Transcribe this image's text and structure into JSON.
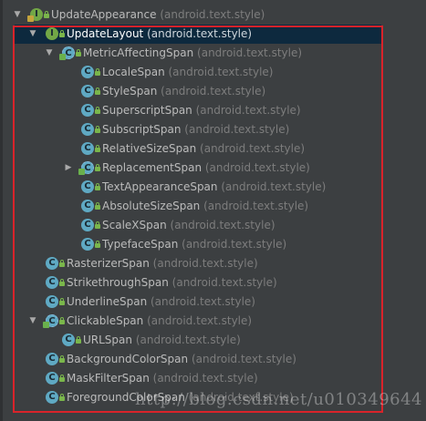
{
  "tree": {
    "rows": [
      {
        "label": "UpdateAppearance",
        "pkg": "(android.text.style)",
        "kind": "interface-ext",
        "arrow": "down",
        "selected": false
      },
      {
        "label": "UpdateLayout",
        "pkg": "(android.text.style)",
        "kind": "interface",
        "arrow": "down",
        "selected": true
      },
      {
        "label": "MetricAffectingSpan",
        "pkg": "(android.text.style)",
        "kind": "abstract-class",
        "arrow": "down",
        "selected": false
      },
      {
        "label": "LocaleSpan",
        "pkg": "(android.text.style)",
        "kind": "class",
        "arrow": "",
        "selected": false
      },
      {
        "label": "StyleSpan",
        "pkg": "(android.text.style)",
        "kind": "class",
        "arrow": "",
        "selected": false
      },
      {
        "label": "SuperscriptSpan",
        "pkg": "(android.text.style)",
        "kind": "class",
        "arrow": "",
        "selected": false
      },
      {
        "label": "SubscriptSpan",
        "pkg": "(android.text.style)",
        "kind": "class",
        "arrow": "",
        "selected": false
      },
      {
        "label": "RelativeSizeSpan",
        "pkg": "(android.text.style)",
        "kind": "class",
        "arrow": "",
        "selected": false
      },
      {
        "label": "ReplacementSpan",
        "pkg": "(android.text.style)",
        "kind": "abstract-class",
        "arrow": "right",
        "selected": false
      },
      {
        "label": "TextAppearanceSpan",
        "pkg": "(android.text.style)",
        "kind": "class",
        "arrow": "",
        "selected": false
      },
      {
        "label": "AbsoluteSizeSpan",
        "pkg": "(android.text.style)",
        "kind": "class",
        "arrow": "",
        "selected": false
      },
      {
        "label": "ScaleXSpan",
        "pkg": "(android.text.style)",
        "kind": "class",
        "arrow": "",
        "selected": false
      },
      {
        "label": "TypefaceSpan",
        "pkg": "(android.text.style)",
        "kind": "class",
        "arrow": "",
        "selected": false
      },
      {
        "label": "RasterizerSpan",
        "pkg": "(android.text.style)",
        "kind": "class",
        "arrow": "",
        "selected": false
      },
      {
        "label": "StrikethroughSpan",
        "pkg": "(android.text.style)",
        "kind": "class",
        "arrow": "",
        "selected": false
      },
      {
        "label": "UnderlineSpan",
        "pkg": "(android.text.style)",
        "kind": "class",
        "arrow": "",
        "selected": false
      },
      {
        "label": "ClickableSpan",
        "pkg": "(android.text.style)",
        "kind": "abstract-class",
        "arrow": "down",
        "selected": false
      },
      {
        "label": "URLSpan",
        "pkg": "(android.text.style)",
        "kind": "class",
        "arrow": "",
        "selected": false
      },
      {
        "label": "BackgroundColorSpan",
        "pkg": "(android.text.style)",
        "kind": "class",
        "arrow": "",
        "selected": false
      },
      {
        "label": "MaskFilterSpan",
        "pkg": "(android.text.style)",
        "kind": "class",
        "arrow": "",
        "selected": false
      },
      {
        "label": "ForegroundColorSpan",
        "pkg": "(android.text.style)",
        "kind": "class",
        "arrow": "",
        "selected": false
      }
    ]
  },
  "watermark": "http://blog.csdn.net/u010349644",
  "colors": {
    "background": "#3c3f41",
    "selection": "#0d293e",
    "highlight_border": "#d9232a",
    "class_icon": "#5fa9c3",
    "interface_icon": "#72a746",
    "lock_icon": "#7ab64b"
  }
}
